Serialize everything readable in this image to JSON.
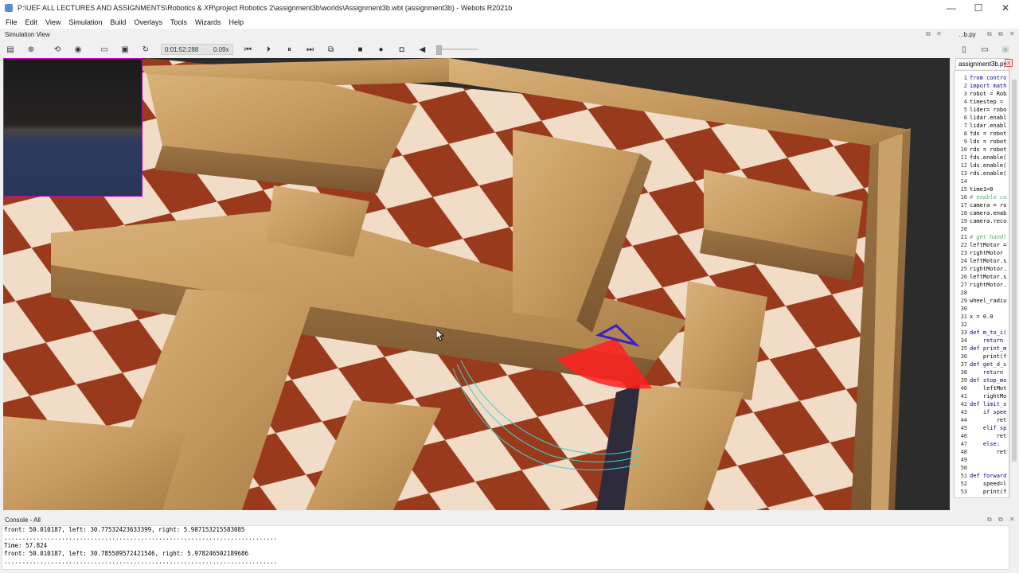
{
  "window": {
    "title": "P:\\UEF ALL LECTURES AND ASSIGNMENTS\\Robotics & XR\\project Robotics 2\\assignment3b\\worlds\\Assignment3b.wbt (assignment3b) - Webots R2021b",
    "minimize": "—",
    "maximize": "☐",
    "close": "✕"
  },
  "menu": [
    "File",
    "Edit",
    "View",
    "Simulation",
    "Build",
    "Overlays",
    "Tools",
    "Wizards",
    "Help"
  ],
  "simulation_panel": {
    "title": "Simulation View"
  },
  "toolbar": {
    "time": "0:01:52:288",
    "speed": "0.09x",
    "icons": [
      "scene-tree-toggle-icon",
      "add-node-icon",
      "reset-view-icon",
      "visibility-icon",
      "open-world-icon",
      "save-world-icon",
      "reload-world-icon",
      "reset-simulation-icon",
      "step-icon",
      "pause-icon",
      "fast-forward-icon",
      "render-toggle-icon",
      "stop-icon",
      "record-icon",
      "screenshot-icon",
      "volume-icon"
    ]
  },
  "editor": {
    "header_label": "...b.py",
    "tab_label": "assignment3b.py",
    "lines": [
      {
        "n": "1",
        "t": "from contro"
      },
      {
        "n": "2",
        "t": "import math"
      },
      {
        "n": "3",
        "t": "robot = Rob"
      },
      {
        "n": "4",
        "t": "timestep ="
      },
      {
        "n": "5",
        "t": "lider= robo"
      },
      {
        "n": "6",
        "t": "lidar.enabl"
      },
      {
        "n": "7",
        "t": "lidar.enabl"
      },
      {
        "n": "8",
        "t": "fds = robot"
      },
      {
        "n": "9",
        "t": "lds = robot"
      },
      {
        "n": "10",
        "t": "rds = robot"
      },
      {
        "n": "11",
        "t": "fds.enable("
      },
      {
        "n": "12",
        "t": "lds.enable("
      },
      {
        "n": "13",
        "t": "rds.enable("
      },
      {
        "n": "14",
        "t": ""
      },
      {
        "n": "15",
        "t": "time1=0"
      },
      {
        "n": "16",
        "t": "# enable ca"
      },
      {
        "n": "17",
        "t": "camera = ro"
      },
      {
        "n": "18",
        "t": "camera.enab"
      },
      {
        "n": "19",
        "t": "camera.reco"
      },
      {
        "n": "20",
        "t": ""
      },
      {
        "n": "21",
        "t": "# get handl"
      },
      {
        "n": "22",
        "t": "leftMotor ="
      },
      {
        "n": "23",
        "t": "rightMotor"
      },
      {
        "n": "24",
        "t": "leftMotor.s"
      },
      {
        "n": "25",
        "t": "rightMotor."
      },
      {
        "n": "26",
        "t": "leftMotor.s"
      },
      {
        "n": "27",
        "t": "rightMotor."
      },
      {
        "n": "28",
        "t": ""
      },
      {
        "n": "29",
        "t": "wheel_radiu"
      },
      {
        "n": "30",
        "t": ""
      },
      {
        "n": "31",
        "t": "x = 0.0"
      },
      {
        "n": "32",
        "t": ""
      },
      {
        "n": "33",
        "t": "def m_to_i("
      },
      {
        "n": "34",
        "t": "    return"
      },
      {
        "n": "35",
        "t": "def print_m"
      },
      {
        "n": "36",
        "t": "    print(f"
      },
      {
        "n": "37",
        "t": "def get_d_s"
      },
      {
        "n": "38",
        "t": "    return"
      },
      {
        "n": "39",
        "t": "def stop_mo"
      },
      {
        "n": "40",
        "t": "    leftMot"
      },
      {
        "n": "41",
        "t": "    rightMo"
      },
      {
        "n": "42",
        "t": "def limit_s"
      },
      {
        "n": "43",
        "t": "    if spee"
      },
      {
        "n": "44",
        "t": "        ret"
      },
      {
        "n": "45",
        "t": "    elif sp"
      },
      {
        "n": "46",
        "t": "        ret"
      },
      {
        "n": "47",
        "t": "    else:"
      },
      {
        "n": "48",
        "t": "        ret"
      },
      {
        "n": "49",
        "t": ""
      },
      {
        "n": "50",
        "t": ""
      },
      {
        "n": "51",
        "t": "def forward"
      },
      {
        "n": "52",
        "t": "    speed=l"
      },
      {
        "n": "53",
        "t": "    print(f"
      }
    ]
  },
  "console": {
    "title": "Console - All",
    "lines": [
      "front: 50.010187, left: 30.77532423633399, right: 5.987153215583085",
      "............................................................................",
      "Time: 57.824",
      "front: 50.010187, left: 30.785589572421546, right: 5.978246502189686",
      "............................................................................"
    ]
  },
  "colors": {
    "board_dark": "#9a3a1c",
    "board_light": "#f1dcc8",
    "wall": "#c59a5e",
    "lidar_cone": "#ff2020",
    "robot_marker": "#3a20c8",
    "path_trail": "#40d0d0",
    "camera_border": "#c000c0"
  }
}
